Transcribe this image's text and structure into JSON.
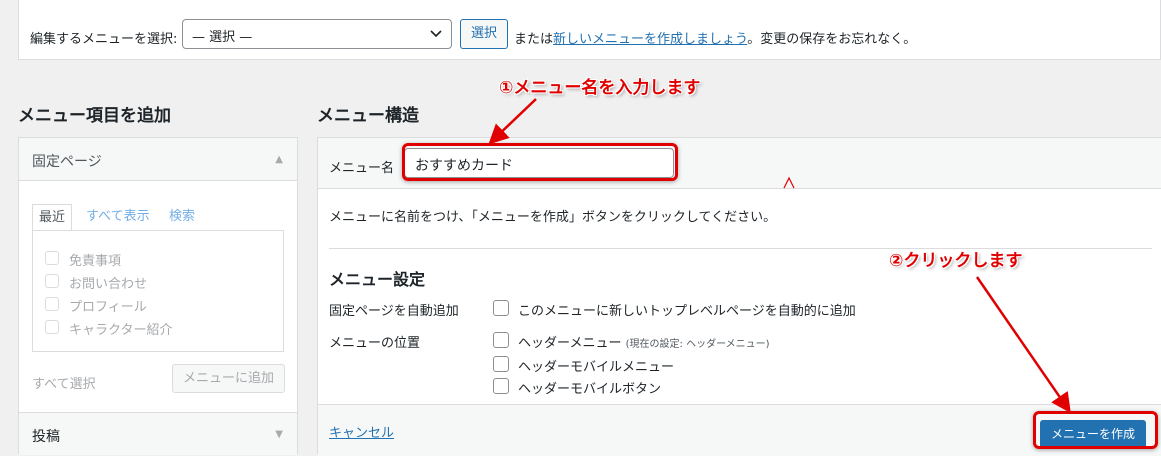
{
  "top_bar": {
    "label": "編集するメニューを選択:",
    "select_value": "— 選択 —",
    "select_button": "選択",
    "or_text": "または",
    "create_link": "新しいメニューを作成しましょう",
    "save_reminder": "。変更の保存をお忘れなく。"
  },
  "left": {
    "heading": "メニュー項目を追加",
    "pages_section": "固定ページ",
    "tabs": [
      "最近",
      "すべて表示",
      "検索"
    ],
    "pages": [
      "免責事項",
      "お問い合わせ",
      "プロフィール",
      "キャラクター紹介"
    ],
    "select_all": "すべて選択",
    "add_button": "メニューに追加",
    "posts_section": "投稿"
  },
  "right": {
    "heading": "メニュー構造",
    "name_label": "メニュー名",
    "name_value": "おすすめカード",
    "instructions": "メニューに名前をつけ、「メニューを作成」ボタンをクリックしてください。",
    "settings_heading": "メニュー設定",
    "auto_add_label": "固定ページを自動追加",
    "auto_add_option": "このメニューに新しいトップレベルページを自動的に追加",
    "location_label": "メニューの位置",
    "locations": [
      {
        "label": "ヘッダーメニュー",
        "note": "(現在の設定: ヘッダーメニュー)"
      },
      {
        "label": "ヘッダーモバイルメニュー",
        "note": ""
      },
      {
        "label": "ヘッダーモバイルボタン",
        "note": ""
      },
      {
        "label": "",
        "note": ""
      }
    ],
    "cancel": "キャンセル",
    "create_button": "メニューを作成"
  },
  "annotations": {
    "step1": "①メニュー名を入力します",
    "step2": "②クリックします"
  },
  "colors": {
    "annotation_red": "#e00000",
    "primary_blue": "#2271b1",
    "link_blue": "#2271b1"
  }
}
